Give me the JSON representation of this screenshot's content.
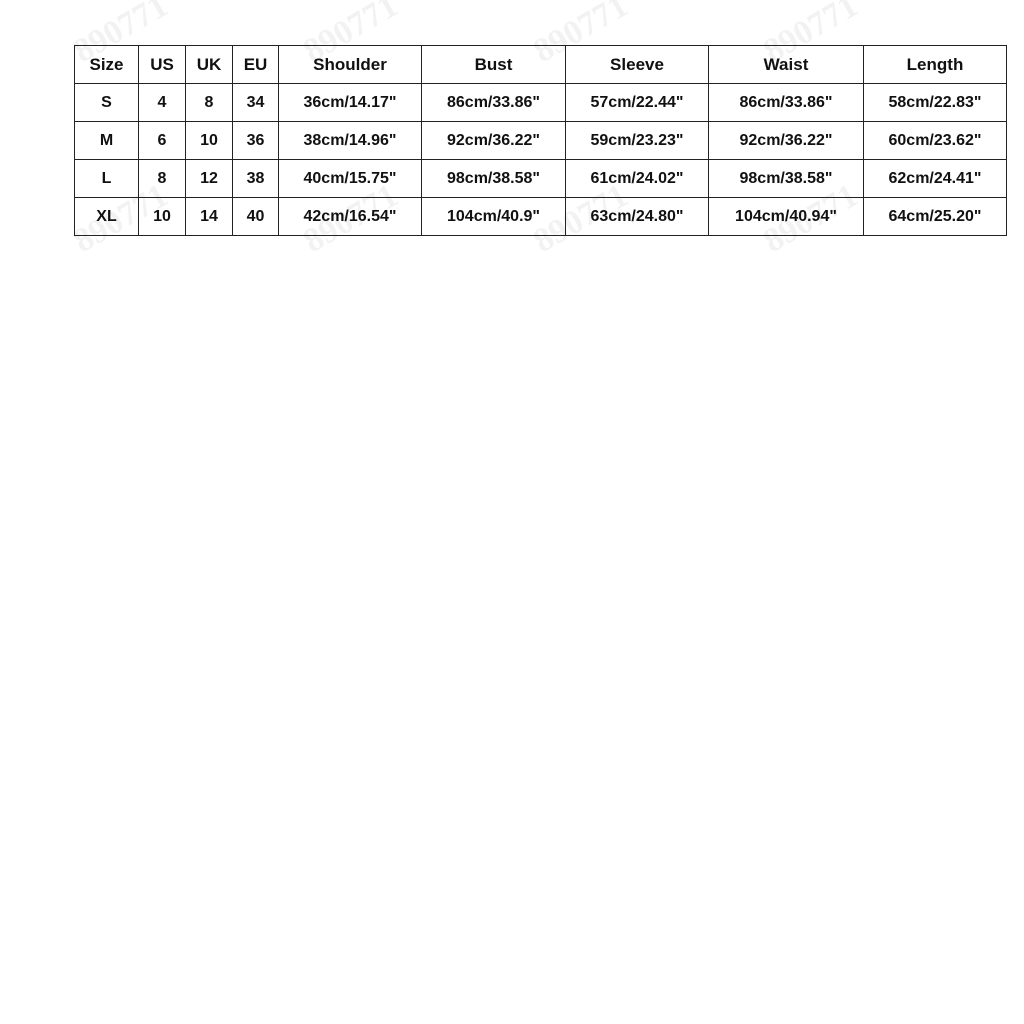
{
  "watermark": "890771",
  "size_chart": {
    "headers": [
      "Size",
      "US",
      "UK",
      "EU",
      "Shoulder",
      "Bust",
      "Sleeve",
      "Waist",
      "Length"
    ],
    "rows": [
      [
        "S",
        "4",
        "8",
        "34",
        "36cm/14.17\"",
        "86cm/33.86\"",
        "57cm/22.44\"",
        "86cm/33.86\"",
        "58cm/22.83\""
      ],
      [
        "M",
        "6",
        "10",
        "36",
        "38cm/14.96\"",
        "92cm/36.22\"",
        "59cm/23.23\"",
        "92cm/36.22\"",
        "60cm/23.62\""
      ],
      [
        "L",
        "8",
        "12",
        "38",
        "40cm/15.75\"",
        "98cm/38.58\"",
        "61cm/24.02\"",
        "98cm/38.58\"",
        "62cm/24.41\""
      ],
      [
        "XL",
        "10",
        "14",
        "40",
        "42cm/16.54\"",
        "104cm/40.9\"",
        "63cm/24.80\"",
        "104cm/40.94\"",
        "64cm/25.20\""
      ]
    ]
  }
}
